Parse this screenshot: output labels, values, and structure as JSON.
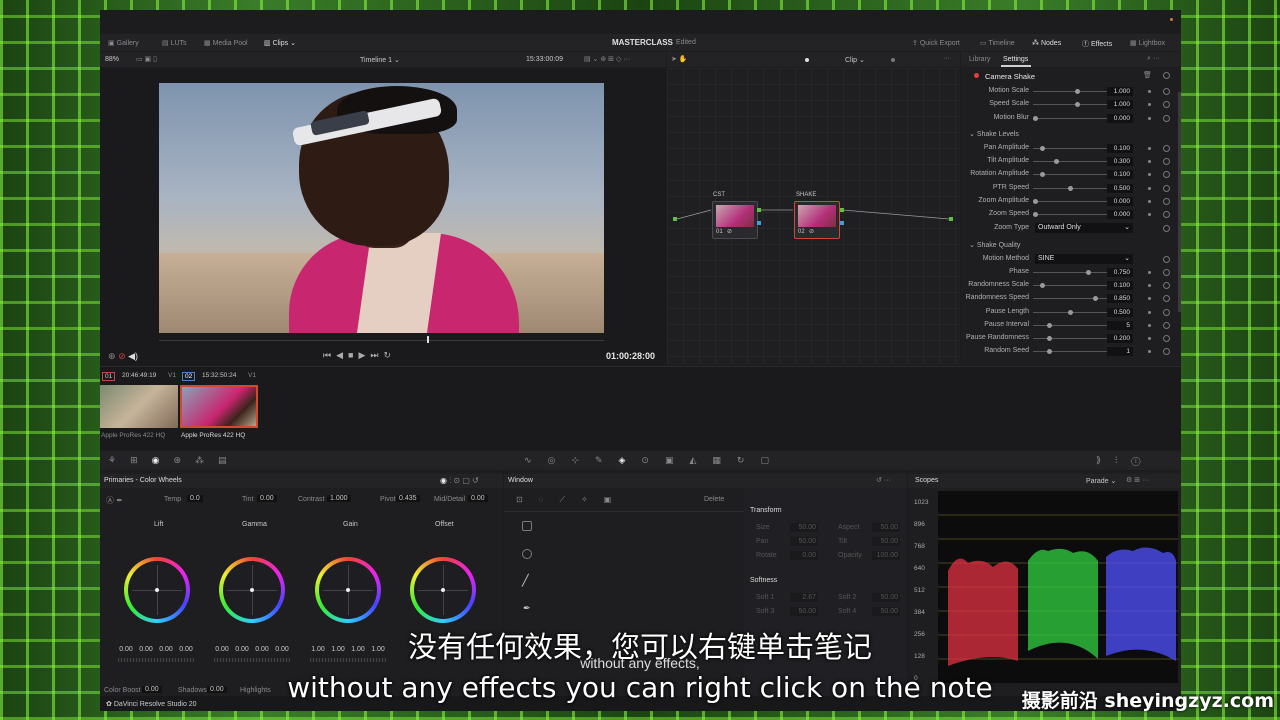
{
  "topbar": {
    "left": [
      "Gallery",
      "LUTs",
      "Media Pool",
      "Clips"
    ],
    "project_title": "MASTERCLASS",
    "project_status": "Edited",
    "right": [
      "Quick Export",
      "Timeline",
      "Nodes",
      "Effects",
      "Lightbox"
    ]
  },
  "viewer": {
    "zoom": "88%",
    "timeline": "Timeline 1",
    "timecode": "15:33:00:09",
    "node_menu": "Clip",
    "playhead_time": "01:00:28:00"
  },
  "nodes": [
    {
      "label": "CST",
      "num": "01"
    },
    {
      "label": "SHAKE",
      "num": "02"
    }
  ],
  "effects_panel": {
    "tabs": [
      "Library",
      "Settings"
    ],
    "effect_name": "Camera Shake",
    "params_top": [
      {
        "name": "Motion Scale",
        "value": "1.000"
      },
      {
        "name": "Speed Scale",
        "value": "1.000"
      },
      {
        "name": "Motion Blur",
        "value": "0.000"
      }
    ],
    "section_levels": "Shake Levels",
    "params_levels": [
      {
        "name": "Pan Amplitude",
        "value": "0.100"
      },
      {
        "name": "Tilt Amplitude",
        "value": "0.300"
      },
      {
        "name": "Rotation Amplitude",
        "value": "0.100"
      },
      {
        "name": "PTR Speed",
        "value": "0.500"
      },
      {
        "name": "Zoom Amplitude",
        "value": "0.000"
      },
      {
        "name": "Zoom Speed",
        "value": "0.000"
      }
    ],
    "zoom_type_label": "Zoom Type",
    "zoom_type_value": "Outward Only",
    "section_quality": "Shake Quality",
    "motion_method_label": "Motion Method",
    "motion_method_value": "SINE",
    "params_quality": [
      {
        "name": "Phase",
        "value": "0.750"
      },
      {
        "name": "Randomness Scale",
        "value": "0.100"
      },
      {
        "name": "Randomness Speed",
        "value": "0.850"
      },
      {
        "name": "Pause Length",
        "value": "0.500"
      },
      {
        "name": "Pause Interval",
        "value": "5"
      },
      {
        "name": "Pause Randomness",
        "value": "0.200"
      },
      {
        "name": "Random Seed",
        "value": "1"
      }
    ]
  },
  "clips": [
    {
      "num": "01",
      "tc": "20:46:49:19",
      "track": "V1",
      "codec": "Apple ProRes 422 HQ"
    },
    {
      "num": "02",
      "tc": "15:32:50:24",
      "track": "V1",
      "codec": "Apple ProRes 422 HQ"
    }
  ],
  "primaries": {
    "title": "Primaries - Color Wheels",
    "temp_label": "Temp",
    "temp": "0.0",
    "tint_label": "Tint",
    "tint": "0.00",
    "contrast_label": "Contrast",
    "contrast": "1.000",
    "pivot_label": "Pivot",
    "pivot": "0.435",
    "middetail_label": "Mid/Detail",
    "middetail": "0.00",
    "wheels": [
      {
        "name": "Lift",
        "values": [
          "0.00",
          "0.00",
          "0.00",
          "0.00"
        ]
      },
      {
        "name": "Gamma",
        "values": [
          "0.00",
          "0.00",
          "0.00",
          "0.00"
        ]
      },
      {
        "name": "Gain",
        "values": [
          "1.00",
          "1.00",
          "1.00",
          "1.00"
        ]
      },
      {
        "name": "Offset",
        "values": [
          "",
          "",
          "",
          ""
        ]
      }
    ],
    "colorboost_label": "Color Boost",
    "colorboost": "0.00",
    "shadows_label": "Shadows",
    "shadows": "0.00",
    "highlights_label": "Highlights"
  },
  "window_panel": {
    "title": "Window",
    "delete": "Delete",
    "transform": "Transform",
    "transform_fields": [
      [
        "Size",
        "50.00"
      ],
      [
        "Aspect",
        "50.00"
      ],
      [
        "Pan",
        "50.00"
      ],
      [
        "Tilt",
        "50.00"
      ],
      [
        "Rotate",
        "0.00"
      ],
      [
        "Opacity",
        "100.00"
      ]
    ],
    "softness": "Softness",
    "softness_fields": [
      [
        "Soft 1",
        "2.67"
      ],
      [
        "Soft 2",
        "50.00"
      ],
      [
        "Soft 3",
        "50.00"
      ],
      [
        "Soft 4",
        "50.00"
      ]
    ]
  },
  "scopes": {
    "title": "Scopes",
    "mode": "Parade",
    "ticks": [
      "1023",
      "896",
      "768",
      "640",
      "512",
      "384",
      "256",
      "128",
      "0"
    ]
  },
  "footer": {
    "app": "DaVinci Resolve Studio 20"
  },
  "subtitles": {
    "zh": "没有任何效果，您可以右键单击笔记",
    "mid": "without any effects,",
    "en": "without any effects you can right click on the note"
  },
  "watermark": "摄影前沿 sheyingzyz.com",
  "colors": {
    "accent": "#e04040",
    "node_select": "#d04a30",
    "scope_red": "#e03040",
    "scope_green": "#30d040",
    "scope_blue": "#5050ff"
  }
}
